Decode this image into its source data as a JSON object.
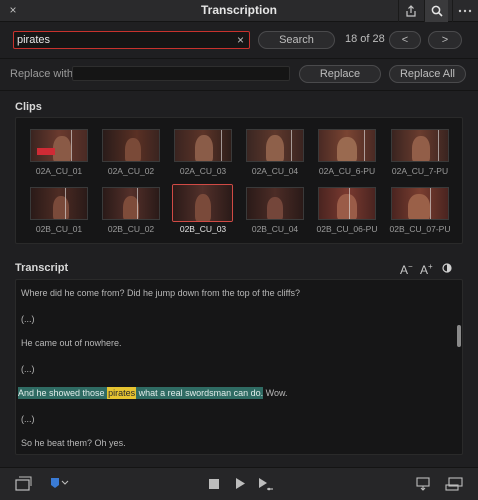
{
  "window": {
    "title": "Transcription",
    "close_glyph": "×"
  },
  "toolbar": {
    "icons": [
      "close-icon",
      "share-icon",
      "search-icon",
      "more-icon"
    ]
  },
  "search": {
    "value": "pirates",
    "clear_glyph": "×",
    "search_button": "Search",
    "counter": "18 of 28",
    "prev_glyph": "<",
    "next_glyph": ">"
  },
  "replace": {
    "label": "Replace with:",
    "value": "",
    "replace_button": "Replace",
    "replace_all_button": "Replace All"
  },
  "clips": {
    "title": "Clips",
    "items": [
      {
        "name": "02A_CU_01"
      },
      {
        "name": "02A_CU_02"
      },
      {
        "name": "02A_CU_03"
      },
      {
        "name": "02A_CU_04"
      },
      {
        "name": "02A_CU_6-PU"
      },
      {
        "name": "02A_CU_7-PU"
      },
      {
        "name": "02B_CU_01"
      },
      {
        "name": "02B_CU_02"
      },
      {
        "name": "02B_CU_03",
        "selected": true
      },
      {
        "name": "02B_CU_04"
      },
      {
        "name": "02B_CU_06-PU"
      },
      {
        "name": "02B_CU_07-PU"
      }
    ]
  },
  "transcript": {
    "title": "Transcript",
    "decrease_font": "A",
    "decrease_sup": "−",
    "increase_font": "A",
    "increase_sup": "+",
    "lines": {
      "l1": "Where did he come from? Did he jump down from the top of the cliffs?",
      "l2": "(...)",
      "l3": "He came out of nowhere.",
      "l4": "(...)",
      "l5_before": "And he showed those ",
      "l5_match": "pirates",
      "l5_after_hl": " what a real swordsman can do.",
      "l5_tail": " Wow.",
      "l6": "(...)",
      "l7": "So he beat them? Oh yes."
    }
  },
  "colors": {
    "accent_red": "#c8322d",
    "highlight_line": "#2f6b63",
    "highlight_word": "#e6c431",
    "flag_blue": "#3a7bd5"
  }
}
